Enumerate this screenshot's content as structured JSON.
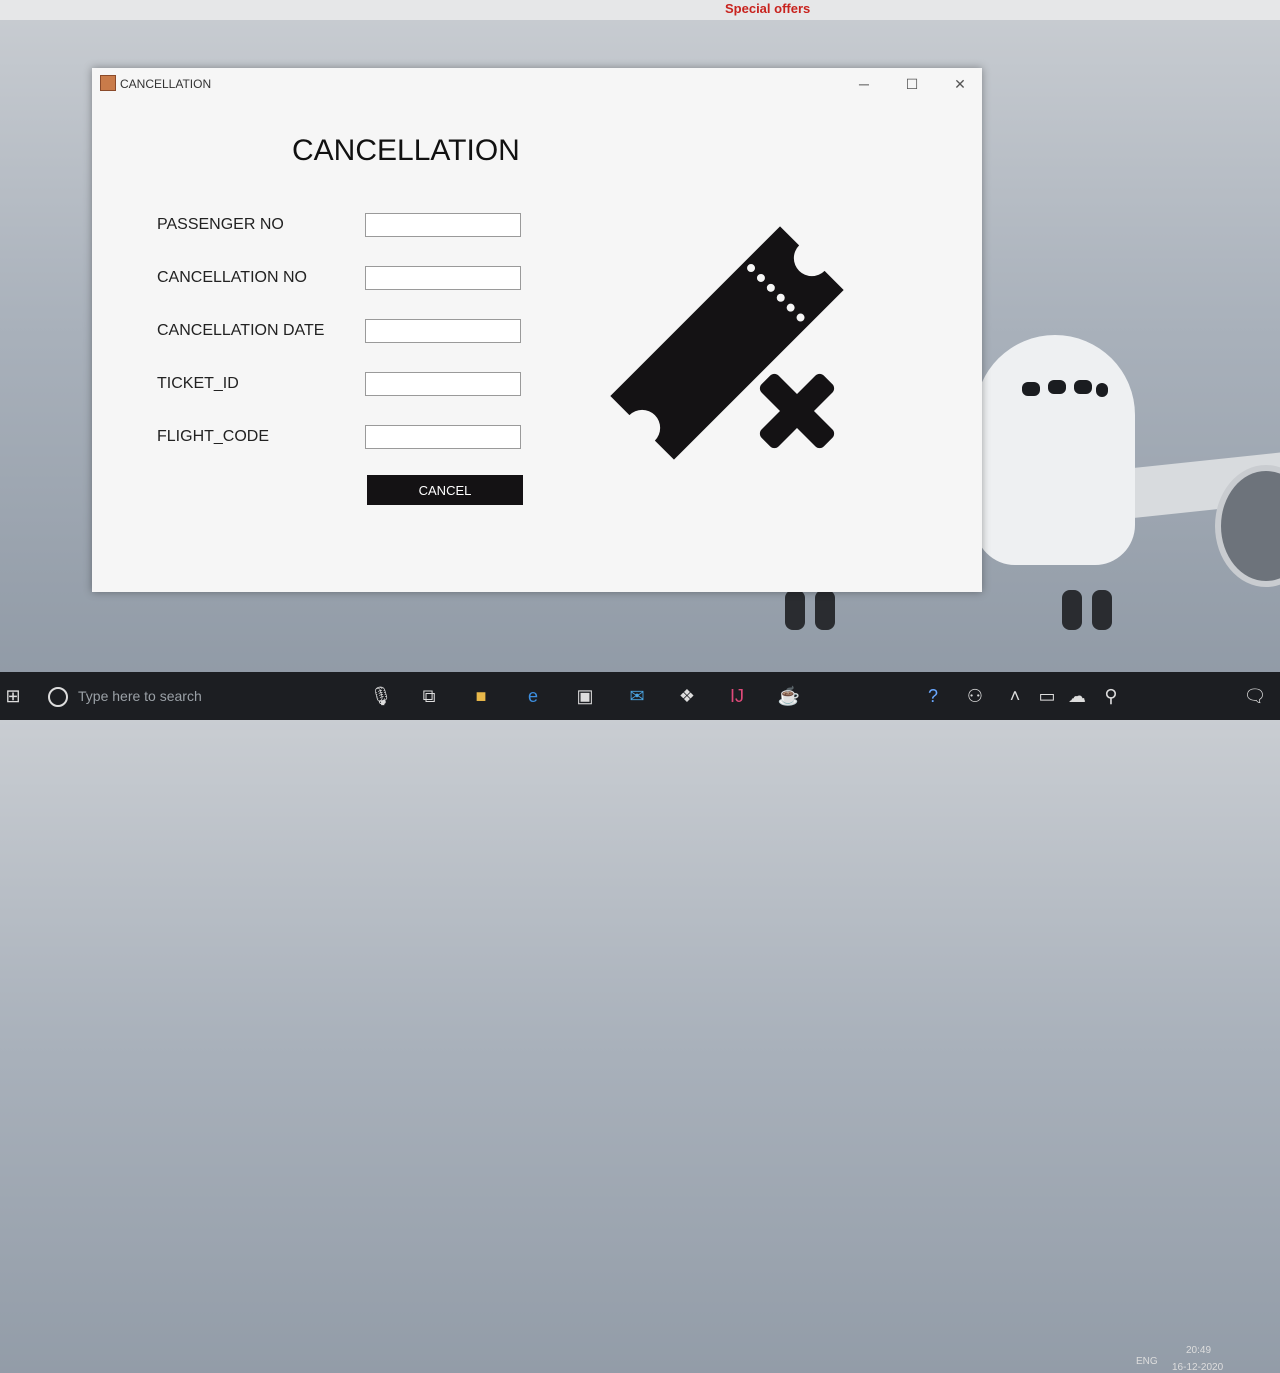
{
  "browser": {
    "banner": "Special offers"
  },
  "window": {
    "title": "CANCELLATION",
    "controls": {
      "minimize": "─",
      "maximize": "☐",
      "close": "✕"
    }
  },
  "form": {
    "heading": "CANCELLATION",
    "fields": [
      {
        "label": "PASSENGER NO",
        "value": ""
      },
      {
        "label": "CANCELLATION NO",
        "value": ""
      },
      {
        "label": "CANCELLATION DATE",
        "value": ""
      },
      {
        "label": "TICKET_ID",
        "value": ""
      },
      {
        "label": "FLIGHT_CODE",
        "value": ""
      }
    ],
    "cancel_label": "CANCEL"
  },
  "illustration": {
    "icon": "ticket-cancel-icon",
    "color": "#141214"
  },
  "taskbar": {
    "search_placeholder": "Type here to search",
    "language": "ENG",
    "time": "20:49",
    "date": "16-12-2020"
  }
}
